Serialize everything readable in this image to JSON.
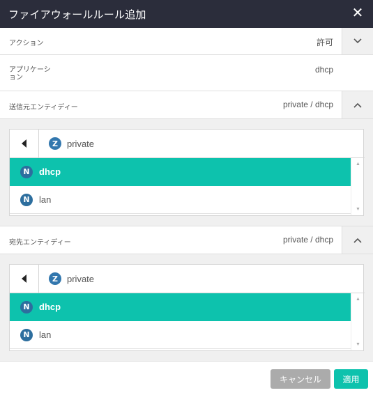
{
  "dialog": {
    "title": "ファイアウォールルール追加",
    "close_icon": "close-icon"
  },
  "fields": {
    "action": {
      "label": "アクション",
      "value": "許可"
    },
    "application": {
      "label_line1": "アプリケーシ",
      "label_line2": "ョン",
      "value": "dhcp"
    },
    "source": {
      "label": "送信元エンティディー",
      "value": "private / dhcp"
    },
    "destination": {
      "label": "宛先エンティディー",
      "value": "private / dhcp"
    }
  },
  "source_picker": {
    "breadcrumb_badge": "Z",
    "breadcrumb": "private",
    "items": [
      {
        "badge": "N",
        "label": "dhcp",
        "selected": true
      },
      {
        "badge": "N",
        "label": "lan",
        "selected": false
      }
    ]
  },
  "destination_picker": {
    "breadcrumb_badge": "Z",
    "breadcrumb": "private",
    "items": [
      {
        "badge": "N",
        "label": "dhcp",
        "selected": true
      },
      {
        "badge": "N",
        "label": "lan",
        "selected": false
      }
    ]
  },
  "footer": {
    "cancel_label": "キャンセル",
    "apply_label": "適用"
  },
  "colors": {
    "titlebar": "#2b2d3b",
    "accent": "#0dc2ad",
    "badge": "#2d6e9e",
    "cancel": "#ababab"
  }
}
